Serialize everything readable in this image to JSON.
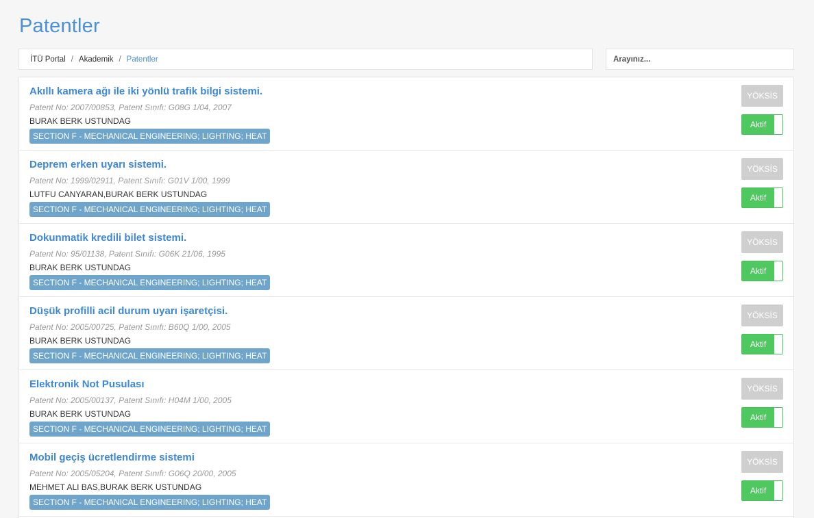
{
  "page": {
    "title": "Patentler"
  },
  "breadcrumb": [
    {
      "label": "İTÜ Portal"
    },
    {
      "label": "Akademik"
    },
    {
      "label": "Patentler"
    }
  ],
  "search": {
    "placeholder": "Arayınız..."
  },
  "patents": [
    {
      "title": "Akıllı kamera ağı ile iki yönlü trafik bilgi sistemi.",
      "meta": "Patent No: 2007/00853, Patent Sınıfı: G08G 1/04, 2007",
      "authors": "BURAK BERK USTUNDAG",
      "section": "SECTION F - MECHANICAL ENGINEERING; LIGHTING; HEAT",
      "yoksis_label": "YÖKSİS",
      "status_label": "Aktif"
    },
    {
      "title": "Deprem erken uyarı sistemi.",
      "meta": "Patent No: 1999/02911, Patent Sınıfı: G01V 1/00, 1999",
      "authors": "LUTFU CANYARAN,BURAK BERK USTUNDAG",
      "section": "SECTION F - MECHANICAL ENGINEERING; LIGHTING; HEAT",
      "yoksis_label": "YÖKSİS",
      "status_label": "Aktif"
    },
    {
      "title": "Dokunmatik kredili bilet sistemi.",
      "meta": "Patent No: 95/01138, Patent Sınıfı: G06K 21/06, 1995",
      "authors": "BURAK BERK USTUNDAG",
      "section": "SECTION F - MECHANICAL ENGINEERING; LIGHTING; HEAT",
      "yoksis_label": "YÖKSİS",
      "status_label": "Aktif"
    },
    {
      "title": "Düşük profilli acil durum uyarı işaretçisi.",
      "meta": "Patent No: 2005/00725, Patent Sınıfı: B60Q 1/00, 2005",
      "authors": "BURAK BERK USTUNDAG",
      "section": "SECTION F - MECHANICAL ENGINEERING; LIGHTING; HEAT",
      "yoksis_label": "YÖKSİS",
      "status_label": "Aktif"
    },
    {
      "title": "Elektronik Not Pusulası",
      "meta": "Patent No: 2005/00137, Patent Sınıfı: H04M 1/00, 2005",
      "authors": "BURAK BERK USTUNDAG",
      "section": "SECTION F - MECHANICAL ENGINEERING; LIGHTING; HEAT",
      "yoksis_label": "YÖKSİS",
      "status_label": "Aktif"
    },
    {
      "title": "Mobil geçiş ücretlendirme sistemi",
      "meta": "Patent No: 2005/05204, Patent Sınıfı: G06Q 20/00, 2005",
      "authors": "MEHMET ALI BAS,BURAK BERK USTUNDAG",
      "section": "SECTION F - MECHANICAL ENGINEERING; LIGHTING; HEAT",
      "yoksis_label": "YÖKSİS",
      "status_label": "Aktif"
    }
  ],
  "colors": {
    "accent": "#4a8fd9",
    "tag": "#6fa5cb",
    "active_green": "#4fc860",
    "yoksis_gray": "#cfcfcf"
  }
}
